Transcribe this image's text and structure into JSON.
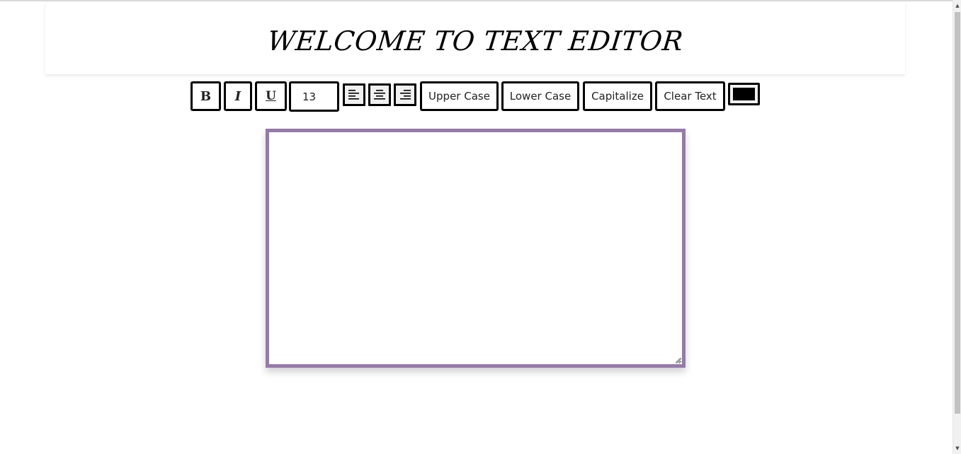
{
  "header": {
    "title": "WELCOME TO TEXT EDITOR"
  },
  "toolbar": {
    "bold_label": "B",
    "italic_label": "I",
    "underline_label": "U",
    "font_size_value": "13",
    "align_left_icon": "align-left-icon",
    "align_center_icon": "align-center-icon",
    "align_right_icon": "align-right-icon",
    "upper_case_label": "Upper Case",
    "lower_case_label": "Lower Case",
    "capitalize_label": "Capitalize",
    "clear_text_label": "Clear Text",
    "text_color": "#000000"
  },
  "editor": {
    "value": "",
    "border_color": "#957aaa"
  }
}
